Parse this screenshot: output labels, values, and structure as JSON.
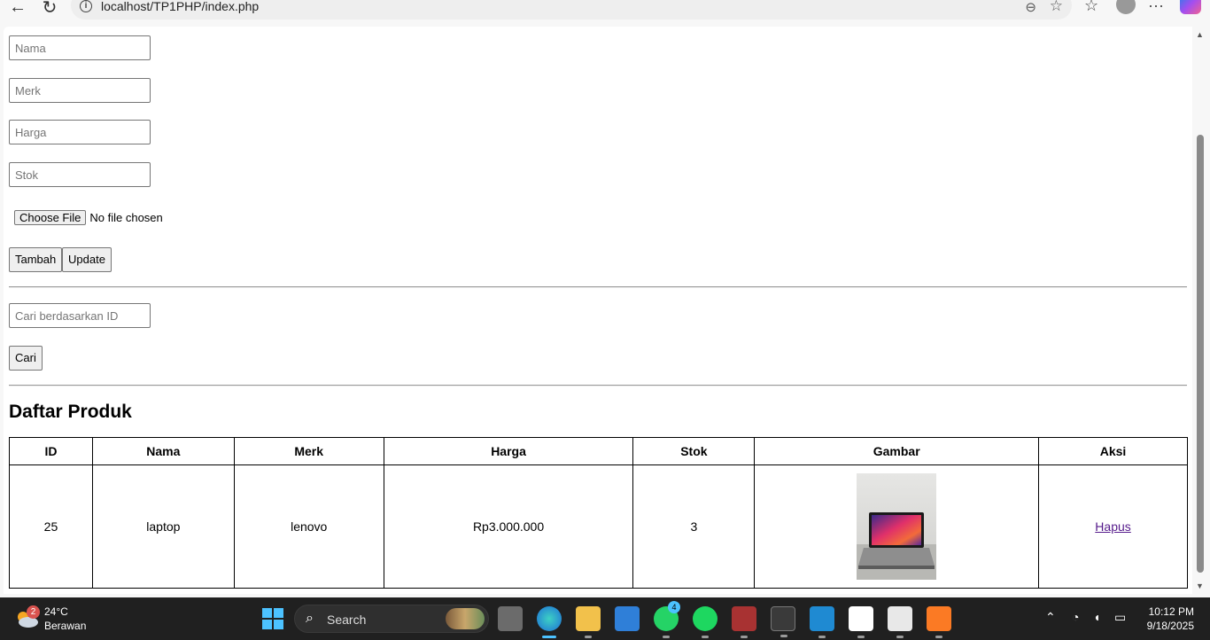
{
  "browser": {
    "url": "localhost/TP1PHP/index.php"
  },
  "form": {
    "nama_placeholder": "Nama",
    "merk_placeholder": "Merk",
    "harga_placeholder": "Harga",
    "stok_placeholder": "Stok",
    "choose_file_label": "Choose File",
    "file_status": "No file chosen",
    "tambah_label": "Tambah",
    "update_label": "Update"
  },
  "search": {
    "placeholder": "Cari berdasarkan ID",
    "button_label": "Cari"
  },
  "product_list": {
    "title": "Daftar Produk",
    "columns": [
      "ID",
      "Nama",
      "Merk",
      "Harga",
      "Stok",
      "Gambar",
      "Aksi"
    ],
    "rows": [
      {
        "id": "25",
        "nama": "laptop",
        "merk": "lenovo",
        "harga": "Rp3.000.000",
        "stok": "3",
        "gambar": "laptop-image",
        "aksi": "Hapus"
      }
    ]
  },
  "taskbar": {
    "weather_temp": "24°C",
    "weather_desc": "Berawan",
    "weather_badge": "2",
    "search_label": "Search",
    "whatsapp_badge": "4",
    "time": "10:12 PM",
    "date": "9/18/2025"
  },
  "colors": {
    "link": "#551a8b",
    "taskbar_bg": "#202020",
    "active_indicator": "#4cc2ff"
  }
}
